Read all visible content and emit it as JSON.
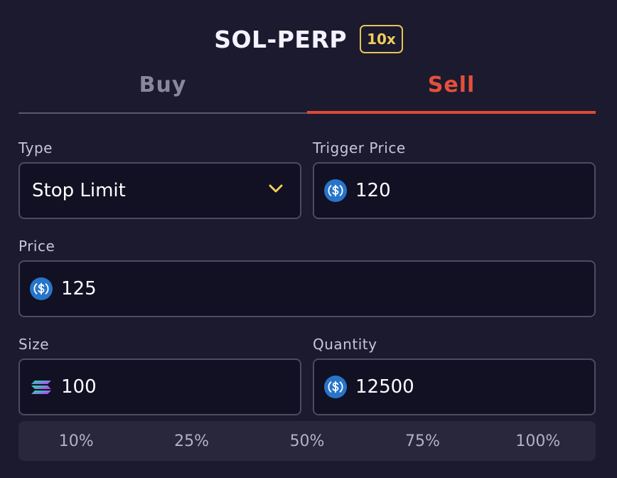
{
  "header": {
    "market": "SOL-PERP",
    "leverage": "10x"
  },
  "tabs": [
    {
      "label": "Buy",
      "active": false
    },
    {
      "label": "Sell",
      "active": true
    }
  ],
  "form": {
    "type": {
      "label": "Type",
      "value": "Stop Limit",
      "icon": "chevron-down-icon"
    },
    "trigger_price": {
      "label": "Trigger Price",
      "value": "120",
      "icon": "usdc-icon"
    },
    "price": {
      "label": "Price",
      "value": "125",
      "icon": "usdc-icon"
    },
    "size": {
      "label": "Size",
      "value": "100",
      "icon": "sol-icon"
    },
    "quantity": {
      "label": "Quantity",
      "value": "12500",
      "icon": "usdc-icon"
    }
  },
  "percent_options": [
    "10%",
    "25%",
    "50%",
    "75%",
    "100%"
  ],
  "colors": {
    "background": "#1c1a2e",
    "sell_accent": "#e4503c",
    "leverage_accent": "#f0cd5e",
    "usdc_blue": "#2775ca"
  }
}
